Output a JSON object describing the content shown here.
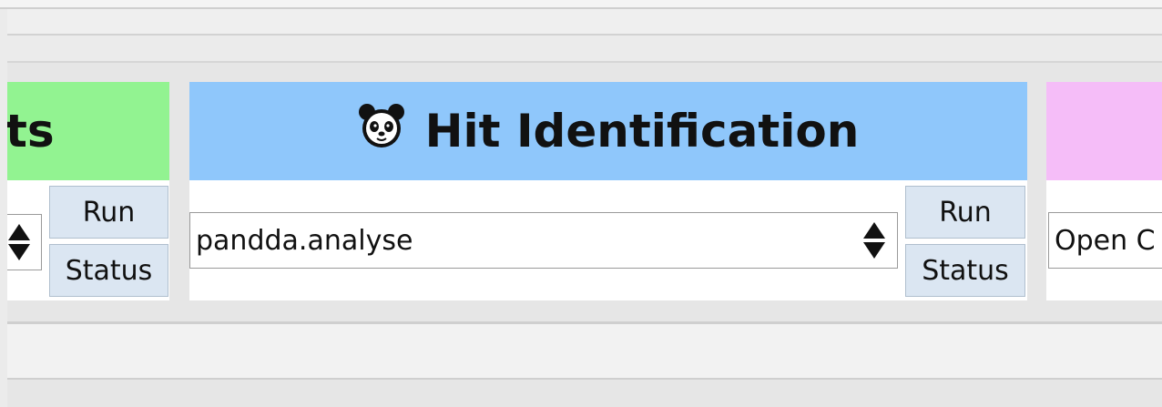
{
  "panels": {
    "left": {
      "title": "ts",
      "run_label": "Run",
      "status_label": "Status",
      "color": "#92f391"
    },
    "middle": {
      "icon": "panda-icon",
      "title": "Hit Identification",
      "selected_program": "pandda.analyse",
      "run_label": "Run",
      "status_label": "Status",
      "color": "#8fc7fb"
    },
    "right": {
      "title": "",
      "selected_program": "Open C",
      "color": "#f5bdf8"
    }
  },
  "colors": {
    "button_bg": "#dbe6f2",
    "window_bg": "#ebebeb"
  }
}
